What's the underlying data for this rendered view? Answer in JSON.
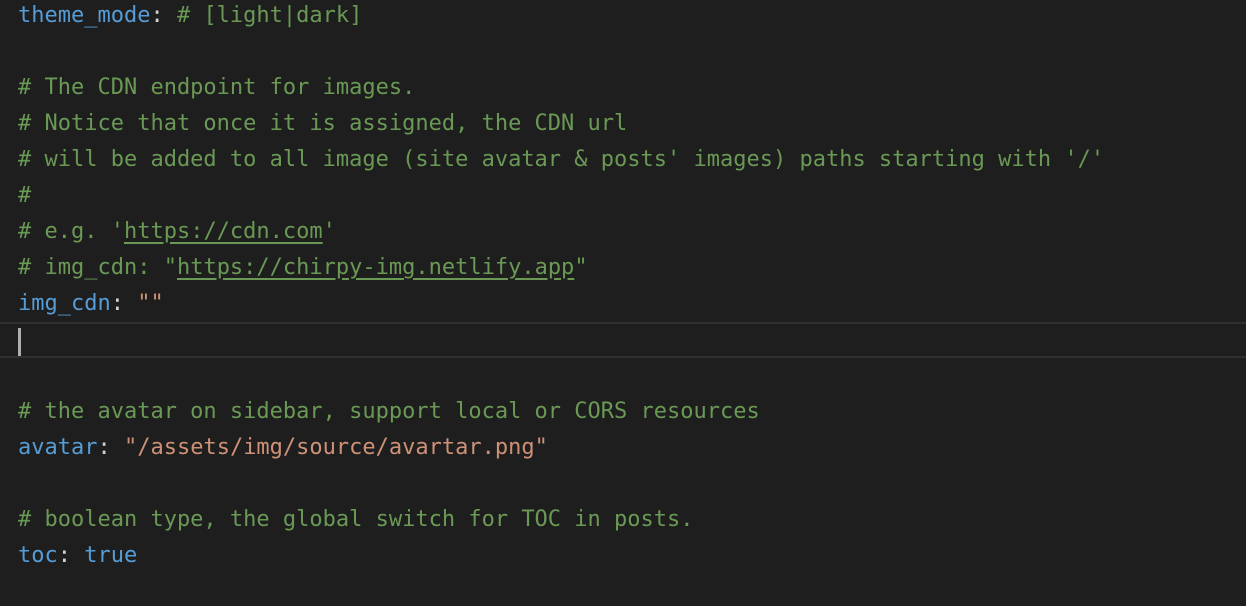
{
  "editor": {
    "lines": {
      "l1": {
        "key": "theme_mode",
        "sep": ":",
        "comment": " # [light|dark]"
      },
      "l3": {
        "comment": "# The CDN endpoint for images."
      },
      "l4": {
        "comment": "# Notice that once it is assigned, the CDN url"
      },
      "l5": {
        "comment": "# will be added to all image (site avatar & posts' images) paths starting with '/'"
      },
      "l6": {
        "comment": "#"
      },
      "l7": {
        "prefix": "# e.g. '",
        "link": "https://cdn.com",
        "suffix": "'"
      },
      "l8": {
        "prefix": "# img_cdn: \"",
        "link": "https://chirpy-img.netlify.app",
        "suffix": "\""
      },
      "l9": {
        "key": "img_cdn",
        "sep": ": ",
        "value": "\"\""
      },
      "l12": {
        "comment": "# the avatar on sidebar, support local or CORS resources"
      },
      "l13": {
        "key": "avatar",
        "sep": ": ",
        "value": "\"/assets/img/source/avartar.png\""
      },
      "l15": {
        "comment": "# boolean type, the global switch for TOC in posts."
      },
      "l16": {
        "key": "toc",
        "sep": ": ",
        "value": "true"
      }
    }
  },
  "colors": {
    "background": "#1e1e1e",
    "key": "#569cd6",
    "comment": "#6a9955",
    "string": "#ce9178",
    "boolean": "#569cd6"
  }
}
